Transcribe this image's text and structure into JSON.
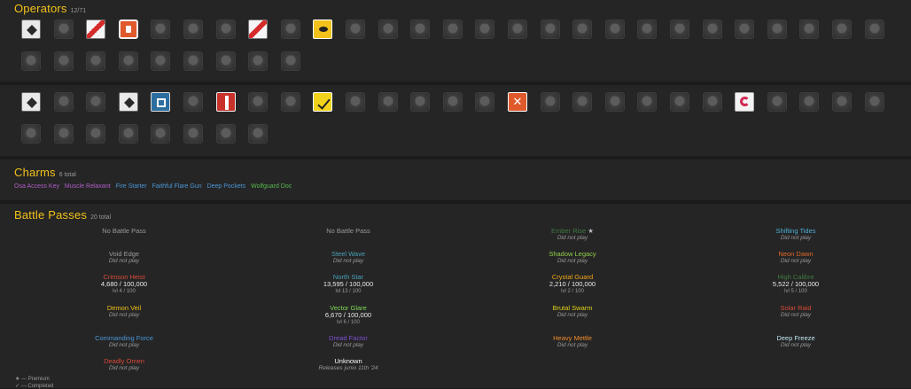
{
  "operators": {
    "title": "Operators",
    "count": "12/71",
    "rows": [
      [
        "white",
        "dark",
        "redwhite",
        "orange",
        "dark",
        "dark",
        "dark",
        "redwhite",
        "dark",
        "yellow",
        "dark",
        "dark",
        "dark",
        "dark",
        "dark",
        "dark",
        "dark",
        "dark",
        "dark",
        "dark",
        "dark",
        "dark",
        "dark",
        "dark",
        "dark",
        "dark",
        "dark"
      ],
      [
        "dark",
        "dark",
        "dark",
        "dark",
        "dark",
        "dark",
        "dark",
        "dark",
        "dark"
      ],
      [
        "white",
        "dark",
        "dark",
        "white",
        "blue",
        "dark",
        "red",
        "dark",
        "dark",
        "ywhite",
        "dark",
        "dark",
        "dark",
        "dark",
        "dark",
        "orangex",
        "dark",
        "dark",
        "dark",
        "dark",
        "dark",
        "dark",
        "pink",
        "dark",
        "dark",
        "dark",
        "dark"
      ],
      [
        "dark",
        "dark",
        "dark",
        "dark",
        "dark",
        "dark",
        "dark",
        "dark"
      ]
    ]
  },
  "charms": {
    "title": "Charms",
    "count": "6 total",
    "items": [
      {
        "label": "Osa Access Key",
        "color": "#b05ec7"
      },
      {
        "label": "Muscle Relaxant",
        "color": "#b05ec7"
      },
      {
        "label": "Fire Starter",
        "color": "#4a97d6"
      },
      {
        "label": "Faithful Flare Gun",
        "color": "#4a97d6"
      },
      {
        "label": "Deep Pockets",
        "color": "#4a97d6"
      },
      {
        "label": "Wolfguard Doc",
        "color": "#58b84f"
      }
    ]
  },
  "battle_passes": {
    "title": "Battle Passes",
    "count": "20 total",
    "columns": [
      [
        {
          "name": "No Battle Pass",
          "color": "#9a9a9a"
        },
        {
          "name": "Void Edge",
          "color": "#9a9a9a",
          "status": "Did not play"
        },
        {
          "name": "Crimson Heist",
          "color": "#d74b3a",
          "progress": "4,680 / 100,000",
          "level": "lvl 4 / 100"
        },
        {
          "name": "Demon Veil",
          "color": "#f2c21a",
          "status": "Did not play"
        },
        {
          "name": "Commanding Force",
          "color": "#4a97d6",
          "status": "Did not play"
        },
        {
          "name": "Deadly Omen",
          "color": "#d74b3a",
          "status": "Did not play"
        }
      ],
      [
        {
          "name": "No Battle Pass",
          "color": "#9a9a9a"
        },
        {
          "name": "Steel Wave",
          "color": "#4aa0b8",
          "status": "Did not play"
        },
        {
          "name": "North Star",
          "color": "#4aa0b8",
          "progress": "13,595 / 100,000",
          "level": "lvl 13 / 100"
        },
        {
          "name": "Vector Glare",
          "color": "#7ed957",
          "progress": "6,670 / 100,000",
          "level": "lvl 6 / 100"
        },
        {
          "name": "Dread Factor",
          "color": "#7a4fcf",
          "status": "Did not play"
        },
        {
          "name": "Unknown",
          "color": "#ffffff",
          "status": "Releases junio 11th '24"
        }
      ],
      [
        {
          "name": "Ember Rise",
          "color": "#3f7a3f",
          "status": "Did not play",
          "premium": "★"
        },
        {
          "name": "Shadow Legacy",
          "color": "#8fcf4a",
          "status": "Did not play"
        },
        {
          "name": "Crystal Guard",
          "color": "#f2a81a",
          "progress": "2,210 / 100,000",
          "level": "lvl 2 / 100"
        },
        {
          "name": "Brutal Swarm",
          "color": "#e0d21a",
          "status": "Did not play"
        },
        {
          "name": "Heavy Mettle",
          "color": "#f08a2a",
          "status": "Did not play"
        }
      ],
      [
        {
          "name": "Shifting Tides",
          "color": "#4ab0d6",
          "status": "Did not play"
        },
        {
          "name": "Neon Dawn",
          "color": "#e06a2a",
          "status": "Did not play"
        },
        {
          "name": "High Calibre",
          "color": "#3f7a3f",
          "progress": "5,522 / 100,000",
          "level": "lvl 5 / 100"
        },
        {
          "name": "Solar Raid",
          "color": "#d74b3a",
          "status": "Did not play"
        },
        {
          "name": "Deep Freeze",
          "color": "#bfe6f2",
          "status": "Did not play"
        }
      ]
    ]
  },
  "legend": {
    "premium": "★ — Premium",
    "completed": "✓ — Completed"
  }
}
